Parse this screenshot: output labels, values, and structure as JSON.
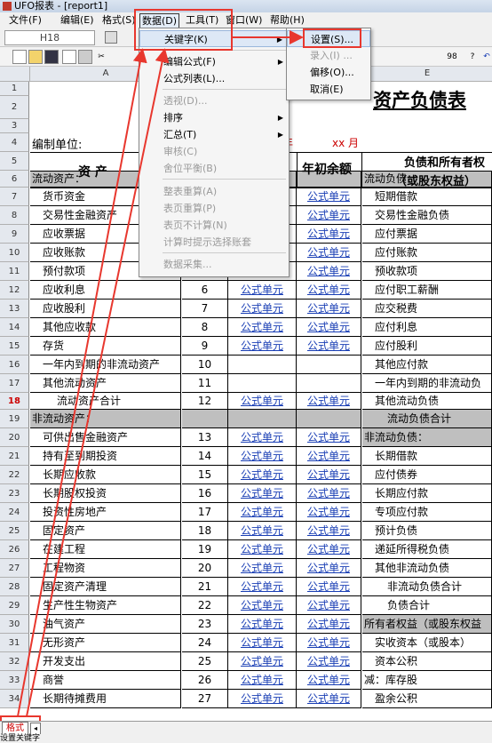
{
  "window": {
    "title": "UFO报表 - [report1]"
  },
  "menubar": {
    "items": [
      {
        "label": "文件(F)"
      },
      {
        "label": "编辑(E)"
      },
      {
        "label": "格式(S)"
      },
      {
        "label": "数据(D)"
      },
      {
        "label": "工具(T)"
      },
      {
        "label": "窗口(W)"
      },
      {
        "label": "帮助(H)"
      }
    ]
  },
  "formula_bar": {
    "cell_ref": "H18"
  },
  "columns": {
    "a": "A",
    "e": "E"
  },
  "sheet": {
    "title": "资产负债表",
    "compiler_label": "编制单位:",
    "year_label": "年",
    "month_label": "xx 月",
    "header_asset": "资  产",
    "header_begin": "年初余额",
    "header_liab": "负债和所有者权",
    "header_equity": "（或股东权益）",
    "formula_unit": "公式单元",
    "rows": [
      {
        "n": "1",
        "a": "",
        "b": "",
        "c": false,
        "d": false,
        "e": ""
      },
      {
        "n": "2",
        "a": "",
        "b": "",
        "c": false,
        "d": false,
        "e": ""
      },
      {
        "n": "3",
        "a": "",
        "b": "",
        "c": false,
        "d": false,
        "e": ""
      },
      {
        "n": "4",
        "a": "",
        "b": "",
        "c": false,
        "d": false,
        "e": ""
      },
      {
        "n": "5",
        "a": "",
        "b": "",
        "c": false,
        "d": false,
        "e": ""
      },
      {
        "n": "6",
        "a": "流动资产：",
        "b": "",
        "c": false,
        "d": false,
        "e": "流动负债：",
        "grey": true
      },
      {
        "n": "7",
        "a": "货币资金",
        "b": "",
        "c": false,
        "d": true,
        "e": "短期借款"
      },
      {
        "n": "8",
        "a": "交易性金融资产",
        "b": "",
        "c": false,
        "d": true,
        "e": "交易性金融负债"
      },
      {
        "n": "9",
        "a": "应收票据",
        "b": "",
        "c": false,
        "d": true,
        "e": "应付票据"
      },
      {
        "n": "10",
        "a": "应收账款",
        "b": "",
        "c": false,
        "d": true,
        "e": "应付账款"
      },
      {
        "n": "11",
        "a": "预付款项",
        "b": "5",
        "c": true,
        "d": true,
        "e": "预收款项"
      },
      {
        "n": "12",
        "a": "应收利息",
        "b": "6",
        "c": true,
        "d": true,
        "e": "应付职工薪酬"
      },
      {
        "n": "13",
        "a": "应收股利",
        "b": "7",
        "c": true,
        "d": true,
        "e": "应交税费"
      },
      {
        "n": "14",
        "a": "其他应收款",
        "b": "8",
        "c": true,
        "d": true,
        "e": "应付利息"
      },
      {
        "n": "15",
        "a": "存货",
        "b": "9",
        "c": true,
        "d": true,
        "e": "应付股利"
      },
      {
        "n": "16",
        "a": "一年内到期的非流动资产",
        "b": "10",
        "c": false,
        "d": false,
        "e": "其他应付款"
      },
      {
        "n": "17",
        "a": "其他流动资产",
        "b": "11",
        "c": false,
        "d": false,
        "e": "一年内到期的非流动负"
      },
      {
        "n": "18",
        "a": "流动资产合计",
        "b": "12",
        "c": true,
        "d": true,
        "e": "其他流动负债",
        "sel": true
      },
      {
        "n": "19",
        "a": "非流动资产：",
        "b": "",
        "c": false,
        "d": false,
        "e": "流动负债合计",
        "grey": true
      },
      {
        "n": "20",
        "a": "可供出售金融资产",
        "b": "13",
        "c": true,
        "d": true,
        "e": "非流动负债：",
        "egrey": true
      },
      {
        "n": "21",
        "a": "持有至到期投资",
        "b": "14",
        "c": true,
        "d": true,
        "e": "长期借款"
      },
      {
        "n": "22",
        "a": "长期应收款",
        "b": "15",
        "c": true,
        "d": true,
        "e": "应付债券"
      },
      {
        "n": "23",
        "a": "长期股权投资",
        "b": "16",
        "c": true,
        "d": true,
        "e": "长期应付款"
      },
      {
        "n": "24",
        "a": "投资性房地产",
        "b": "17",
        "c": true,
        "d": true,
        "e": "专项应付款"
      },
      {
        "n": "25",
        "a": "固定资产",
        "b": "18",
        "c": true,
        "d": true,
        "e": "预计负债"
      },
      {
        "n": "26",
        "a": "在建工程",
        "b": "19",
        "c": true,
        "d": true,
        "e": "递延所得税负债"
      },
      {
        "n": "27",
        "a": "工程物资",
        "b": "20",
        "c": true,
        "d": true,
        "e": "其他非流动负债"
      },
      {
        "n": "28",
        "a": "固定资产清理",
        "b": "21",
        "c": true,
        "d": true,
        "e": "非流动负债合计"
      },
      {
        "n": "29",
        "a": "生产性生物资产",
        "b": "22",
        "c": true,
        "d": true,
        "e": "负债合计"
      },
      {
        "n": "30",
        "a": "油气资产",
        "b": "23",
        "c": true,
        "d": true,
        "e": "所有者权益（或股东权益",
        "egrey": true
      },
      {
        "n": "31",
        "a": "无形资产",
        "b": "24",
        "c": true,
        "d": true,
        "e": "实收资本（或股本）"
      },
      {
        "n": "32",
        "a": "开发支出",
        "b": "25",
        "c": true,
        "d": true,
        "e": "资本公积"
      },
      {
        "n": "33",
        "a": "商誉",
        "b": "26",
        "c": true,
        "d": true,
        "e": "减：库存股"
      },
      {
        "n": "34",
        "a": "长期待摊费用",
        "b": "27",
        "c": true,
        "d": true,
        "e": "盈余公积"
      }
    ]
  },
  "data_menu": {
    "items": [
      {
        "label": "关键字(K)",
        "state": "highlight",
        "submenu": true
      },
      {
        "label": "编辑公式(F)",
        "state": "normal",
        "submenu": true
      },
      {
        "label": "公式列表(L)...",
        "state": "normal"
      },
      {
        "label": "透视(D)...",
        "state": "disabled"
      },
      {
        "label": "排序",
        "state": "normal",
        "submenu": true
      },
      {
        "label": "汇总(T)",
        "state": "normal",
        "submenu": true
      },
      {
        "label": "审核(C)",
        "state": "disabled"
      },
      {
        "label": "舍位平衡(B)",
        "state": "disabled"
      },
      {
        "label": "整表重算(A)",
        "state": "disabled"
      },
      {
        "label": "表页重算(P)",
        "state": "disabled"
      },
      {
        "label": "表页不计算(N)",
        "state": "disabled"
      },
      {
        "label": "计算时提示选择账套",
        "state": "disabled"
      },
      {
        "label": "数据采集...",
        "state": "disabled"
      }
    ]
  },
  "keyword_submenu": {
    "items": [
      {
        "label": "设置(S)...",
        "state": "highlight"
      },
      {
        "label": "录入(I) ...",
        "state": "disabled"
      },
      {
        "label": "偏移(O)...",
        "state": "normal"
      },
      {
        "label": "取消(E)",
        "state": "normal"
      }
    ]
  },
  "sheet_tab": {
    "label": "格式"
  },
  "status": {
    "text": "设置关键字"
  },
  "colors": {
    "annotation_red": "#e8372e",
    "link_blue": "#1a3fb5",
    "grey_fill": "#bfbfbf"
  }
}
